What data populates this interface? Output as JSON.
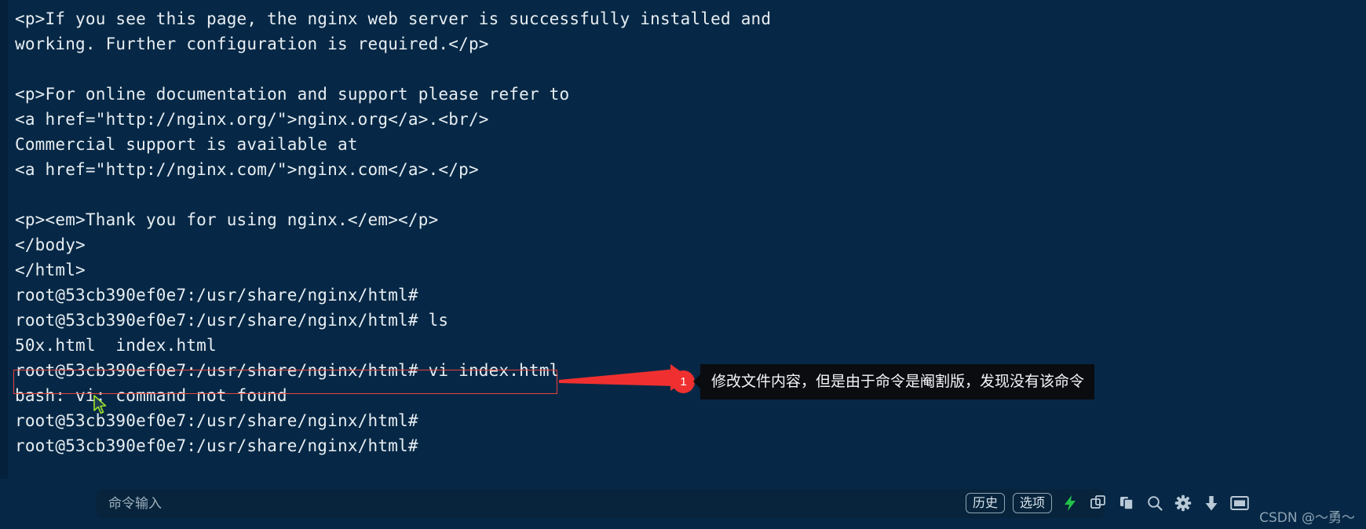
{
  "terminal": {
    "background_color": "#062846",
    "text_color": "#e8eef2",
    "lines": [
      "<p>If you see this page, the nginx web server is successfully installed and",
      "working. Further configuration is required.</p>",
      "",
      "<p>For online documentation and support please refer to",
      "<a href=\"http://nginx.org/\">nginx.org</a>.<br/>",
      "Commercial support is available at",
      "<a href=\"http://nginx.com/\">nginx.com</a>.</p>",
      "",
      "<p><em>Thank you for using nginx.</em></p>",
      "</body>",
      "</html>",
      "root@53cb390ef0e7:/usr/share/nginx/html#",
      "root@53cb390ef0e7:/usr/share/nginx/html# ls",
      "50x.html  index.html",
      "root@53cb390ef0e7:/usr/share/nginx/html# vi index.html",
      "bash: vi: command not found",
      "root@53cb390ef0e7:/usr/share/nginx/html#",
      "root@53cb390ef0e7:/usr/share/nginx/html#"
    ],
    "highlighted_line_index": 14
  },
  "annotation": {
    "badge_number": "1",
    "text": "修改文件内容，但是由于命令是阉割版，发现没有该命令",
    "highlight_color": "#e8443a",
    "arrow_color": "#f03030",
    "callout_background": "#0a0c10"
  },
  "bottom_bar": {
    "command_input": {
      "value": "",
      "placeholder": "命令输入"
    },
    "buttons": [
      {
        "label": "历史",
        "name": "history-button"
      },
      {
        "label": "选项",
        "name": "options-button"
      }
    ],
    "icons": [
      {
        "name": "lightning-icon",
        "color": "#21c24a"
      },
      {
        "name": "copy-icon",
        "color": "#b9c9d6"
      },
      {
        "name": "paste-icon",
        "color": "#b9c9d6"
      },
      {
        "name": "search-icon",
        "color": "#b9c9d6"
      },
      {
        "name": "gear-icon",
        "color": "#b9c9d6"
      },
      {
        "name": "download-icon",
        "color": "#b9c9d6"
      },
      {
        "name": "window-icon",
        "color": "#b9c9d6"
      }
    ]
  },
  "watermark": {
    "text": "CSDN @～勇～"
  }
}
